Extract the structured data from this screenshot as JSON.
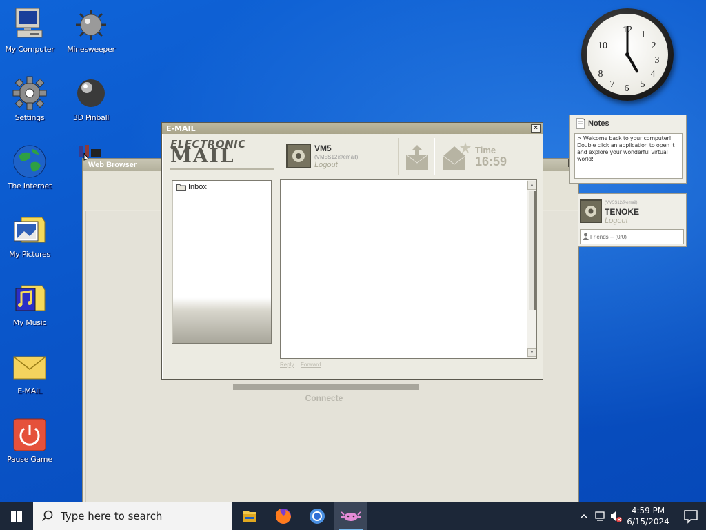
{
  "desktop": {
    "icons": [
      {
        "label": "My Computer"
      },
      {
        "label": "Minesweeper"
      },
      {
        "label": "Settings"
      },
      {
        "label": "3D Pinball"
      },
      {
        "label": "The Internet"
      },
      {
        "label": "My Pictures"
      },
      {
        "label": "My Music"
      },
      {
        "label": "E-MAIL"
      },
      {
        "label": "Pause Game"
      }
    ]
  },
  "clock_widget": {
    "numbers": [
      "12",
      "1",
      "2",
      "3",
      "4",
      "5",
      "6",
      "7",
      "8",
      "10"
    ],
    "hour": 5,
    "minute": 0
  },
  "browser": {
    "title": "Web Browser",
    "status": "Connecte"
  },
  "email": {
    "title": "E-MAIL",
    "logo_top": "ELECTRONIC",
    "logo_bottom": "MAIL",
    "account": {
      "name": "VM5",
      "sub": "(VM5S12@email)",
      "logout": "Logout"
    },
    "time_label": "Time",
    "time_value": "16:59",
    "folders": [
      {
        "label": "Inbox"
      }
    ],
    "reply_label": "Reply",
    "forward_label": "Forward",
    "close_label": "×"
  },
  "notes": {
    "title": "Notes",
    "body": "> Welcome back to your computer! Double click an application to open it and explore your wonderful virtual world!"
  },
  "messenger": {
    "sub": "(VM5S12@email)",
    "name": "TENOKE",
    "logout": "Logout",
    "friends": "Friends -- (0/0)"
  },
  "taskbar": {
    "search_placeholder": "Type here to search",
    "time": "4:59 PM",
    "date": "6/15/2024"
  },
  "colors": {
    "desktop_blue": "#0b57cc",
    "window_chrome": "#ecebe2",
    "title_bar": "#b1ad93",
    "taskbar": "#1c2738"
  }
}
